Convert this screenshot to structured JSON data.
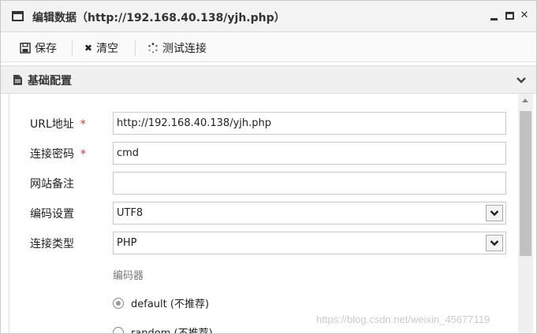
{
  "window": {
    "title": "编辑数据（http://192.168.40.138/yjh.php）",
    "controls": {
      "minimize_icon": "minimize-icon",
      "maximize_icon": "maximize-icon",
      "close_icon": "close-icon",
      "close_glyph": "✕"
    }
  },
  "toolbar": {
    "save_label": "保存",
    "clear_label": "清空",
    "test_label": "测试连接",
    "clear_glyph": "✖"
  },
  "section": {
    "title": "基础配置"
  },
  "form": {
    "url": {
      "label": "URL地址",
      "required": "*",
      "value": "http://192.168.40.138/yjh.php"
    },
    "password": {
      "label": "连接密码",
      "required": "*",
      "value": "cmd"
    },
    "note": {
      "label": "网站备注",
      "value": ""
    },
    "encoding": {
      "label": "编码设置",
      "value": "UTF8"
    },
    "type": {
      "label": "连接类型",
      "value": "PHP"
    },
    "encoder": {
      "label": "编码器",
      "options": [
        {
          "label": "default (不推荐)",
          "checked": true
        },
        {
          "label": "random (不推荐)",
          "checked": false
        }
      ]
    }
  },
  "watermark": "https://blog.csdn.net/weixin_45677119",
  "colors": {
    "required": "#d9302c",
    "title_bar": "#f3f3f3",
    "section_bar": "#f0f0f0"
  }
}
